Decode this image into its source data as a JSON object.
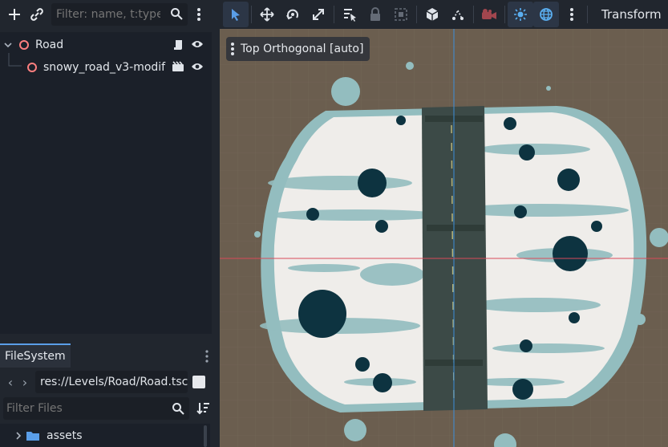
{
  "scene_panel": {
    "filter_placeholder": "Filter: name, t:type, g:group",
    "nodes": [
      {
        "label": "Road",
        "depth": 0
      },
      {
        "label": "snowy_road_v3-modif",
        "depth": 1
      }
    ]
  },
  "filesystem": {
    "tab_label": "FileSystem",
    "path": "res://Levels/Road/Road.tscn",
    "filter_placeholder": "Filter Files",
    "items": [
      {
        "label": "assets"
      }
    ]
  },
  "viewport": {
    "toolbar_label": "Transform",
    "view_label": "Top Orthogonal [auto]"
  },
  "colors": {
    "accent": "#5a9ee8",
    "node_ring": "#fc7f7f",
    "viewport_bg": "#6b5e4f",
    "snow": "#efedea",
    "ice": "#93bdbf",
    "asphalt": "#3c4a47",
    "axis_blue": "#3d8fd8",
    "axis_red": "#d84a5a"
  }
}
